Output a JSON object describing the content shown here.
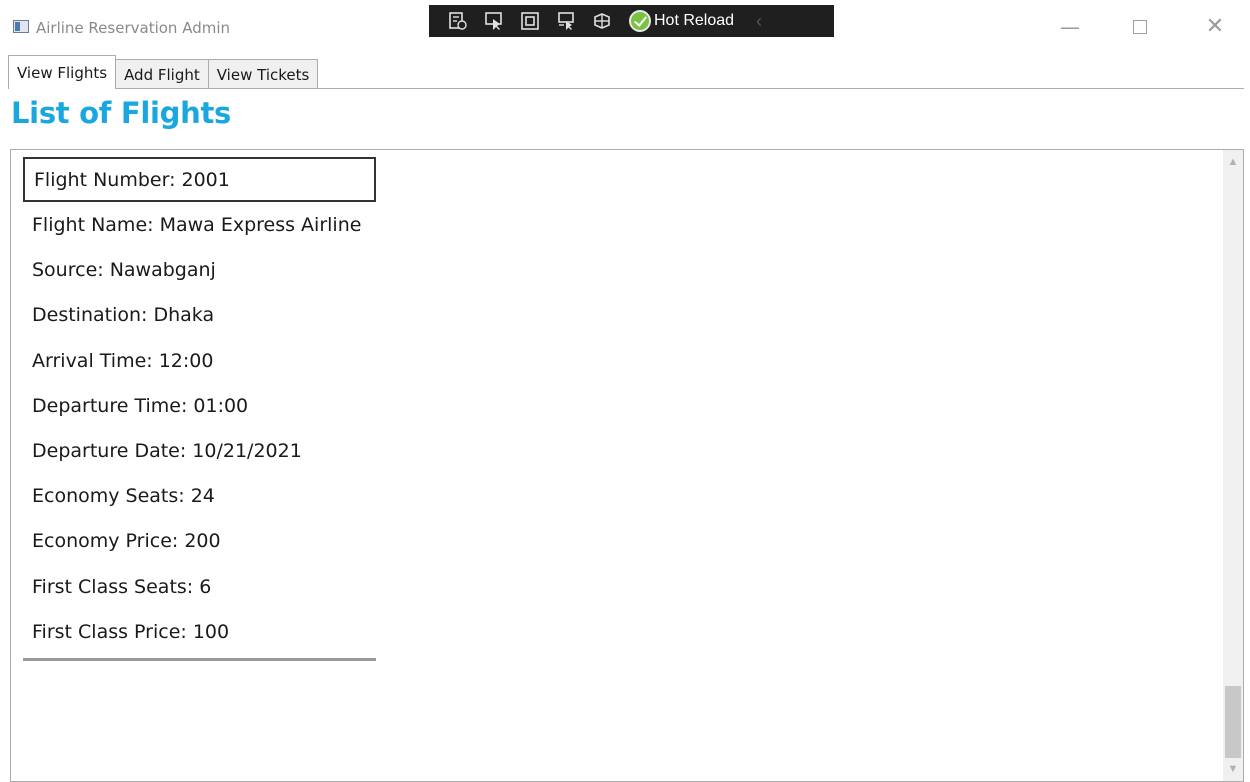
{
  "window": {
    "title": "Airline Reservation Admin",
    "minimize_label": "—",
    "close_label": "✕"
  },
  "debug_toolbar": {
    "hot_reload_label": "Hot Reload",
    "collapse_label": "‹"
  },
  "tabs": [
    {
      "label": "View Flights",
      "active": true
    },
    {
      "label": "Add Flight",
      "active": false
    },
    {
      "label": "View Tickets",
      "active": false
    }
  ],
  "page": {
    "title": "List of Flights"
  },
  "flight": {
    "fields": [
      "Flight Number: 2001",
      "Flight Name: Mawa Express Airline",
      "Source: Nawabganj",
      "Destination: Dhaka",
      "Arrival Time: 12:00",
      "Departure Time: 01:00",
      "Departure Date: 10/21/2021",
      "Economy Seats: 24",
      "Economy Price: 200",
      "First Class Seats: 6",
      "First Class Price: 100"
    ]
  },
  "scrollbar": {
    "up_label": "▲",
    "down_label": "▼"
  },
  "colors": {
    "accent": "#1aa7df",
    "hot_reload_ok": "#7cc242",
    "toolbar_bg": "#1f1f1f"
  }
}
